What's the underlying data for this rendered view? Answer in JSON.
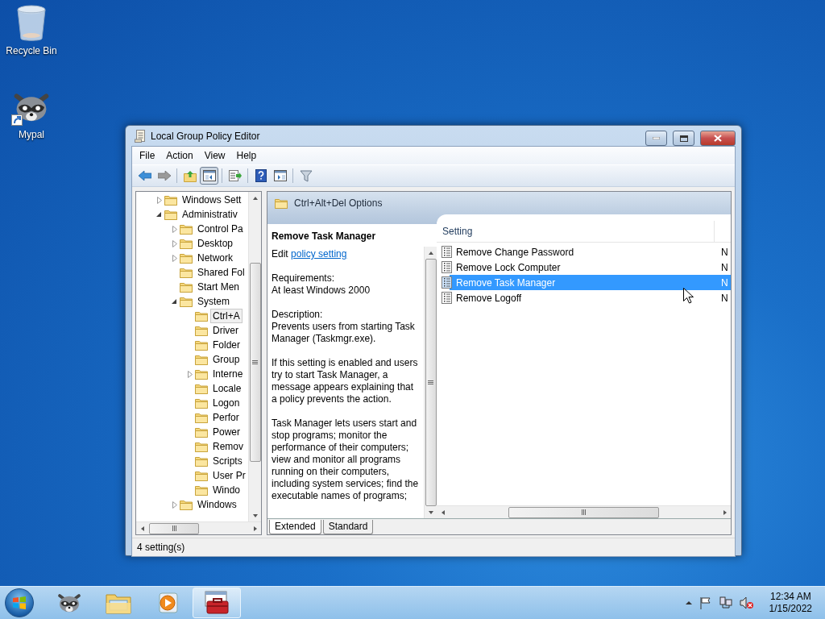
{
  "desktop_icons": [
    {
      "label": "Recycle Bin",
      "kind": "recycle"
    },
    {
      "label": "Mypal",
      "kind": "raccoon"
    }
  ],
  "window": {
    "title": "Local Group Policy Editor"
  },
  "menu": [
    "File",
    "Action",
    "View",
    "Help"
  ],
  "toolbar": [
    {
      "kind": "back",
      "pressed": false
    },
    {
      "kind": "forward",
      "pressed": false
    },
    {
      "kind": "separator"
    },
    {
      "kind": "up",
      "pressed": false
    },
    {
      "kind": "console_tree",
      "pressed": true
    },
    {
      "kind": "separator"
    },
    {
      "kind": "export",
      "pressed": false
    },
    {
      "kind": "separator"
    },
    {
      "kind": "help",
      "pressed": false
    },
    {
      "kind": "action_pane",
      "pressed": false
    },
    {
      "kind": "separator"
    },
    {
      "kind": "filter",
      "pressed": false
    }
  ],
  "tree": [
    {
      "label": "Windows Sett",
      "expanded": false,
      "selected": false
    },
    {
      "label": "Administrativ",
      "expanded": true,
      "selected": false,
      "children": [
        {
          "label": "Control Pa",
          "expanded": false,
          "selected": false
        },
        {
          "label": "Desktop",
          "expanded": false,
          "selected": false
        },
        {
          "label": "Network",
          "expanded": false,
          "selected": false
        },
        {
          "label": "Shared Fol",
          "selected": false
        },
        {
          "label": "Start Men",
          "selected": false
        },
        {
          "label": "System",
          "expanded": true,
          "selected": false,
          "children": [
            {
              "label": "Ctrl+A",
              "selected": true
            },
            {
              "label": "Driver",
              "selected": false
            },
            {
              "label": "Folder",
              "selected": false
            },
            {
              "label": "Group",
              "selected": false
            },
            {
              "label": "Interne",
              "expanded": false,
              "selected": false
            },
            {
              "label": "Locale",
              "selected": false
            },
            {
              "label": "Logon",
              "selected": false
            },
            {
              "label": "Perfor",
              "selected": false
            },
            {
              "label": "Power",
              "selected": false
            },
            {
              "label": "Remov",
              "selected": false
            },
            {
              "label": "Scripts",
              "selected": false
            },
            {
              "label": "User Pr",
              "selected": false
            },
            {
              "label": "Windo",
              "selected": false
            }
          ]
        },
        {
          "label": "Windows",
          "expanded": false,
          "selected": false
        }
      ]
    }
  ],
  "details": {
    "header": "Ctrl+Alt+Del Options",
    "description": {
      "title": "Remove Task Manager",
      "edit_prefix": "Edit",
      "link": "policy setting",
      "blocks": [
        {
          "heading": "Requirements:",
          "text": "At least Windows 2000"
        },
        {
          "heading": "Description:",
          "text": "Prevents users from starting Task Manager (Taskmgr.exe)."
        },
        {
          "text": "If this setting is enabled and users try to start Task Manager, a message appears explaining that a policy prevents the action."
        },
        {
          "text": "Task Manager lets users start and stop programs; monitor the performance of their computers; view and monitor all programs running on their computers, including system services; find the executable names of programs;"
        }
      ]
    },
    "columns": [
      "Setting"
    ],
    "rows": [
      {
        "name": "Remove Change Password",
        "column_2": "N",
        "selected": false
      },
      {
        "name": "Remove Lock Computer",
        "column_2": "N",
        "selected": false
      },
      {
        "name": "Remove Task Manager",
        "column_2": "N",
        "selected": true
      },
      {
        "name": "Remove Logoff",
        "column_2": "N",
        "selected": false
      }
    ],
    "tabs": [
      {
        "label": "Extended",
        "selected": true
      },
      {
        "label": "Standard",
        "selected": false
      }
    ]
  },
  "status_bar": "4 setting(s)",
  "taskbar": {
    "buttons": [
      {
        "kind": "raccoon",
        "active": false
      },
      {
        "kind": "explorer",
        "active": false
      },
      {
        "kind": "media",
        "active": false
      },
      {
        "kind": "policy",
        "active": true
      }
    ],
    "time": "12:34 AM",
    "date": "1/15/2022"
  }
}
